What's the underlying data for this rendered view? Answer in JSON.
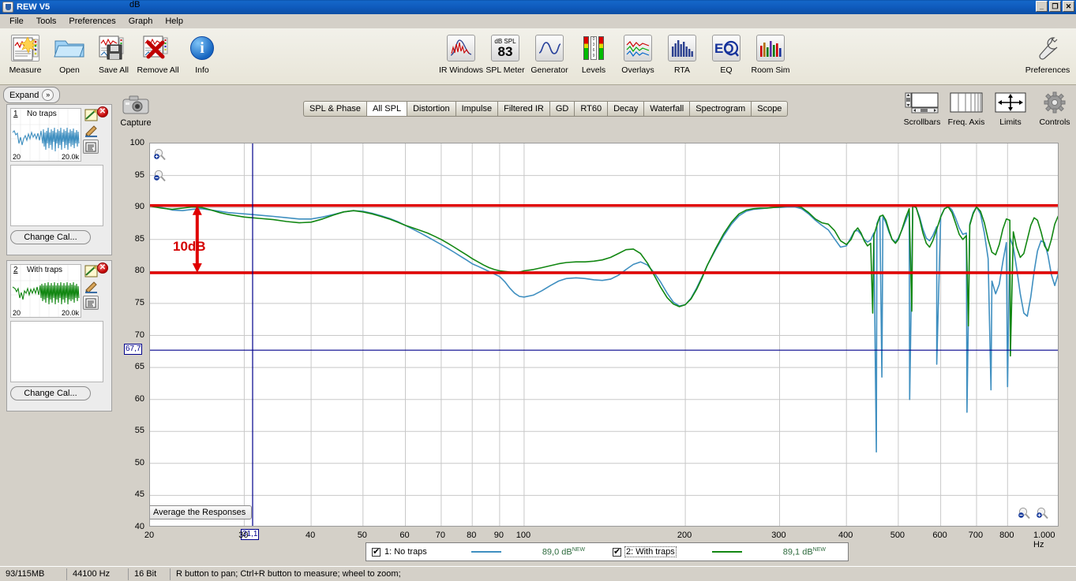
{
  "window": {
    "title": "REW V5",
    "app_icon": "java-cup-icon",
    "buttons": {
      "minimize": "_",
      "maximize": "❐",
      "close": "✕"
    }
  },
  "menu": {
    "items": [
      "File",
      "Tools",
      "Preferences",
      "Graph",
      "Help"
    ]
  },
  "toolbar": {
    "left_items": [
      {
        "label": "Measure",
        "icon": "measure-icon"
      },
      {
        "label": "Open",
        "icon": "folder-open-icon"
      },
      {
        "label": "Save All",
        "icon": "save-all-icon"
      },
      {
        "label": "Remove All",
        "icon": "remove-all-icon"
      },
      {
        "label": "Info",
        "icon": "info-icon"
      }
    ],
    "center_items": [
      {
        "label": "IR Windows",
        "icon": "ir-windows-icon"
      },
      {
        "label": "SPL Meter",
        "icon": "spl-meter-icon",
        "value": "83",
        "unit": "dB SPL"
      },
      {
        "label": "Generator",
        "icon": "generator-icon"
      },
      {
        "label": "Levels",
        "icon": "levels-icon"
      },
      {
        "label": "Overlays",
        "icon": "overlays-icon"
      },
      {
        "label": "RTA",
        "icon": "rta-icon"
      },
      {
        "label": "EQ",
        "icon": "eq-icon"
      },
      {
        "label": "Room Sim",
        "icon": "room-sim-icon"
      }
    ],
    "right_items": [
      {
        "label": "Preferences",
        "icon": "wrench-icon"
      }
    ]
  },
  "left_panel": {
    "expand_label": "Expand",
    "expand_icon": "chevron-double-right-icon",
    "measurements": [
      {
        "number": "1",
        "name": "No traps",
        "thumb_low": "20",
        "thumb_high": "20.0k",
        "trace_color": "#3f8fc0",
        "change_cal_label": "Change Cal...",
        "close_icon": "close-icon",
        "edit_icon": "edit-icon",
        "pencil_icon": "pencil-icon",
        "notes_icon": "notes-icon"
      },
      {
        "number": "2",
        "name": "With traps",
        "thumb_low": "20",
        "thumb_high": "20.0k",
        "trace_color": "#128712",
        "change_cal_label": "Change Cal...",
        "close_icon": "close-icon",
        "edit_icon": "edit-icon",
        "pencil_icon": "pencil-icon",
        "notes_icon": "notes-icon"
      }
    ]
  },
  "capture": {
    "label": "Capture",
    "icon": "camera-icon"
  },
  "graph_tabs": {
    "items": [
      "SPL & Phase",
      "All SPL",
      "Distortion",
      "Impulse",
      "Filtered IR",
      "GD",
      "RT60",
      "Decay",
      "Waterfall",
      "Spectrogram",
      "Scope"
    ],
    "active": "All SPL"
  },
  "graph_tools": [
    {
      "label": "Scrollbars",
      "icon": "scrollbars-icon"
    },
    {
      "label": "Freq. Axis",
      "icon": "freq-axis-icon"
    },
    {
      "label": "Limits",
      "icon": "limits-icon"
    },
    {
      "label": "Controls",
      "icon": "gear-icon"
    }
  ],
  "plot_overlay": {
    "zoom_in_icon": "zoom-in-icon",
    "zoom_out_icon": "zoom-out-icon",
    "x_zoom_out_icon": "zoom-out-icon",
    "x_zoom_in_icon": "zoom-in-icon",
    "average_button": "Average the Responses",
    "cursor_y_value": "67,7",
    "cursor_x_value": "31,1",
    "annotation_label": "10dB",
    "annotation_color": "#d40000",
    "marker_line_upper_db": 90.3,
    "marker_line_lower_db": 79.8
  },
  "legend": {
    "entries": [
      {
        "checked": true,
        "label": "1: No traps",
        "color": "#3f8fc0",
        "value": "89,0 dB",
        "badge": "NEW"
      },
      {
        "checked": true,
        "label": "2: With traps",
        "color": "#128712",
        "value": "89,1 dB",
        "badge": "NEW"
      }
    ]
  },
  "status_bar": {
    "memory": "93/115MB",
    "sample_rate": "44100 Hz",
    "bit_depth": "16 Bit",
    "hint": "R button to pan; Ctrl+R button to measure; wheel to zoom;"
  },
  "chart_data": {
    "type": "line",
    "title": "All SPL",
    "xlabel": "Hz",
    "ylabel": "dB",
    "xscale": "log",
    "xlim": [
      20,
      1000
    ],
    "ylim": [
      40,
      100
    ],
    "grid": true,
    "legend_position": "bottom",
    "yticks": [
      100,
      95,
      90,
      85,
      80,
      75,
      70,
      65,
      60,
      55,
      50,
      45,
      40
    ],
    "xticks": [
      20,
      30,
      40,
      50,
      60,
      70,
      80,
      90,
      100,
      200,
      300,
      400,
      500,
      600,
      700,
      800,
      1000
    ],
    "xtick_labels": [
      "20",
      "30",
      "40",
      "50",
      "60",
      "70",
      "80",
      "90",
      "100",
      "200",
      "300",
      "400",
      "500",
      "600",
      "700",
      "800",
      "1.000 Hz"
    ],
    "annotations": [
      {
        "type": "hline",
        "y": 90.3,
        "color": "#e00000",
        "label": ""
      },
      {
        "type": "hline",
        "y": 79.8,
        "color": "#e00000",
        "label": ""
      },
      {
        "type": "arrow",
        "x": 24.5,
        "y0": 79.8,
        "y1": 90.3,
        "color": "#e00000",
        "label": "10dB"
      },
      {
        "type": "vline",
        "x": 31.1,
        "color": "#00008b",
        "label": "31,1"
      },
      {
        "type": "hline",
        "y": 67.7,
        "color": "#00008b",
        "label": "67,7"
      }
    ],
    "series": [
      {
        "name": "1: No traps",
        "color": "#3f8fc0",
        "level": "89,0 dB",
        "x": [
          20,
          21,
          22,
          23,
          24,
          25,
          26,
          27,
          28,
          29,
          30,
          31,
          32,
          34,
          36,
          38,
          40,
          42,
          44,
          46,
          48,
          50,
          52,
          54,
          56,
          58,
          60,
          62,
          64,
          66,
          68,
          70,
          72,
          74,
          76,
          78,
          80,
          82,
          84,
          86,
          88,
          90,
          92,
          94,
          96,
          98,
          100,
          104,
          108,
          112,
          116,
          120,
          125,
          130,
          135,
          140,
          145,
          150,
          155,
          160,
          165,
          170,
          175,
          180,
          185,
          190,
          195,
          200,
          205,
          210,
          215,
          220,
          228,
          236,
          244,
          252,
          260,
          268,
          276,
          284,
          292,
          300,
          310,
          320,
          330,
          340,
          350,
          360,
          370,
          380,
          390,
          400,
          408,
          414,
          420,
          426,
          432,
          438,
          444,
          450,
          456,
          462,
          468,
          474,
          480,
          487,
          494,
          500,
          508,
          516,
          524,
          532,
          540,
          548,
          556,
          564,
          572,
          580,
          590,
          600,
          610,
          620,
          630,
          640,
          650,
          660,
          670,
          680,
          690,
          700,
          712,
          724,
          736,
          748,
          760,
          772,
          784,
          796,
          808,
          820,
          832,
          845,
          858,
          871,
          884,
          897,
          910,
          924,
          938,
          952,
          966,
          980,
          994,
          1000
        ],
        "y": [
          90.4,
          90.0,
          89.6,
          89.5,
          89.7,
          89.8,
          89.6,
          89.4,
          89.2,
          89.1,
          89.0,
          88.9,
          88.8,
          88.6,
          88.4,
          88.2,
          88.2,
          88.5,
          88.9,
          89.3,
          89.5,
          89.4,
          89.1,
          88.7,
          88.3,
          87.8,
          87.2,
          86.6,
          86.0,
          85.4,
          84.8,
          84.2,
          83.6,
          83.0,
          82.4,
          81.8,
          81.2,
          80.8,
          80.4,
          80.0,
          79.6,
          79.2,
          78.4,
          77.4,
          76.6,
          76.1,
          76.0,
          76.3,
          77.0,
          77.8,
          78.5,
          78.9,
          79.0,
          78.9,
          78.7,
          78.6,
          78.8,
          79.4,
          80.3,
          81.1,
          81.5,
          81.0,
          79.8,
          78.3,
          76.6,
          75.2,
          74.6,
          74.8,
          75.8,
          77.4,
          79.2,
          81.0,
          83.4,
          85.6,
          87.4,
          88.7,
          89.4,
          89.7,
          89.8,
          89.9,
          90.0,
          90.0,
          90.1,
          90.1,
          89.8,
          89.0,
          88.0,
          87.2,
          86.5,
          85.1,
          83.8,
          84.0,
          85.3,
          86.3,
          86.4,
          85.8,
          85.0,
          84.6,
          84.9,
          86.0,
          87.5,
          88.6,
          88.6,
          87.6,
          86.2,
          85.0,
          84.6,
          85.2,
          86.5,
          87.9,
          89.3,
          90.2,
          90.0,
          88.5,
          86.6,
          85.2,
          84.8,
          85.6,
          87.0,
          88.6,
          89.8,
          90.2,
          89.6,
          88.3,
          86.8,
          85.8,
          86.0,
          87.4,
          89.2,
          90.1,
          89.0,
          86.0,
          82.0,
          78.5,
          76.5,
          78.0,
          81.5,
          84.5,
          85.3,
          83.8,
          80.5,
          76.5,
          73.5,
          73.0,
          76.0,
          80.0,
          83.2,
          84.8,
          84.5,
          82.5,
          79.5,
          77.8,
          79.5,
          83.0,
          85.5,
          86.4,
          85.5
        ],
        "y_nulls": [
          {
            "x": 455,
            "y": 51.8
          },
          {
            "x": 466,
            "y": 63.5
          },
          {
            "x": 525,
            "y": 60.0
          },
          {
            "x": 590,
            "y": 65.5
          },
          {
            "x": 672,
            "y": 58.0
          },
          {
            "x": 745,
            "y": 61.5
          },
          {
            "x": 800,
            "y": 62.0
          }
        ]
      },
      {
        "name": "2: With traps",
        "color": "#128712",
        "level": "89,1 dB",
        "x": [
          20,
          21,
          22,
          23,
          24,
          25,
          26,
          27,
          28,
          29,
          30,
          31,
          32,
          34,
          36,
          38,
          40,
          42,
          44,
          46,
          48,
          50,
          52,
          54,
          56,
          58,
          60,
          62,
          64,
          66,
          68,
          70,
          72,
          74,
          76,
          78,
          80,
          82,
          84,
          86,
          88,
          90,
          92,
          94,
          96,
          98,
          100,
          104,
          108,
          112,
          116,
          120,
          125,
          130,
          135,
          140,
          145,
          150,
          155,
          160,
          165,
          170,
          175,
          180,
          185,
          190,
          195,
          200,
          205,
          210,
          215,
          220,
          228,
          236,
          244,
          252,
          260,
          268,
          276,
          284,
          292,
          300,
          310,
          320,
          330,
          340,
          350,
          360,
          370,
          380,
          390,
          400,
          408,
          414,
          420,
          426,
          432,
          438,
          444,
          450,
          456,
          462,
          468,
          474,
          480,
          487,
          494,
          500,
          508,
          516,
          524,
          532,
          540,
          548,
          556,
          564,
          572,
          580,
          590,
          600,
          610,
          620,
          630,
          640,
          650,
          660,
          670,
          680,
          690,
          700,
          712,
          724,
          736,
          748,
          760,
          772,
          784,
          796,
          808,
          820,
          832,
          845,
          858,
          871,
          884,
          897,
          910,
          924,
          938,
          952,
          966,
          980,
          994,
          1000
        ],
        "y": [
          90.2,
          89.9,
          89.7,
          89.9,
          90.1,
          90.0,
          89.6,
          89.2,
          88.9,
          88.7,
          88.5,
          88.4,
          88.3,
          88.1,
          87.8,
          87.6,
          87.7,
          88.2,
          88.8,
          89.3,
          89.5,
          89.3,
          89.0,
          88.6,
          88.2,
          87.7,
          87.2,
          86.8,
          86.4,
          86.0,
          85.5,
          85.0,
          84.4,
          83.8,
          83.2,
          82.6,
          82.0,
          81.5,
          81.0,
          80.6,
          80.3,
          80.1,
          80.0,
          79.9,
          79.8,
          79.9,
          80.1,
          80.3,
          80.6,
          80.9,
          81.2,
          81.4,
          81.5,
          81.5,
          81.6,
          81.8,
          82.2,
          82.8,
          83.4,
          83.5,
          82.8,
          81.3,
          79.4,
          77.5,
          75.9,
          74.9,
          74.5,
          74.8,
          75.7,
          77.2,
          79.0,
          81.0,
          83.6,
          85.9,
          87.7,
          89.0,
          89.6,
          89.8,
          89.9,
          89.9,
          90.0,
          90.1,
          90.2,
          90.3,
          90.0,
          89.2,
          88.2,
          87.6,
          87.4,
          86.4,
          84.8,
          84.2,
          85.0,
          86.2,
          86.8,
          86.0,
          84.8,
          84.0,
          84.4,
          85.6,
          87.2,
          88.6,
          88.8,
          88.0,
          86.5,
          85.0,
          84.4,
          85.0,
          86.6,
          88.4,
          89.8,
          90.3,
          90.0,
          88.2,
          86.0,
          84.4,
          83.8,
          84.8,
          86.6,
          88.5,
          89.8,
          90.1,
          89.2,
          87.5,
          85.8,
          85.0,
          85.6,
          87.2,
          89.0,
          90.1,
          89.4,
          87.6,
          85.0,
          83.0,
          82.6,
          84.2,
          86.6,
          88.2,
          88.0,
          86.2,
          83.8,
          82.2,
          82.8,
          85.0,
          87.2,
          88.4,
          88.0,
          86.2,
          84.0,
          83.2,
          85.0,
          87.4,
          88.6,
          88.0,
          86.6
        ],
        "y_nulls": [
          {
            "x": 448,
            "y": 73.5
          },
          {
            "x": 530,
            "y": 73.8
          },
          {
            "x": 676,
            "y": 71.5
          },
          {
            "x": 810,
            "y": 66.8
          }
        ]
      }
    ]
  }
}
